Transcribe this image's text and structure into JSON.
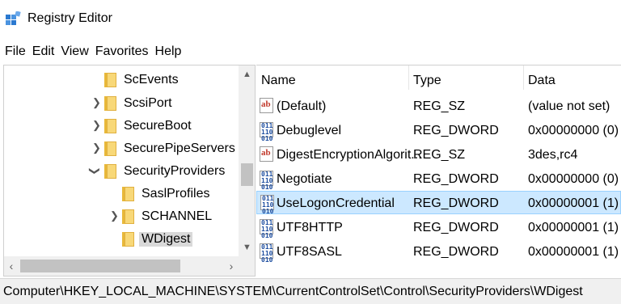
{
  "window": {
    "title": "Registry Editor"
  },
  "menu": [
    "File",
    "Edit",
    "View",
    "Favorites",
    "Help"
  ],
  "tree": [
    {
      "label": "ScEvents",
      "expander": "none"
    },
    {
      "label": "ScsiPort",
      "expander": "collapsed"
    },
    {
      "label": "SecureBoot",
      "expander": "collapsed"
    },
    {
      "label": "SecurePipeServers",
      "expander": "collapsed"
    },
    {
      "label": "SecurityProviders",
      "expander": "expanded"
    },
    {
      "label": "SaslProfiles",
      "expander": "none"
    },
    {
      "label": "SCHANNEL",
      "expander": "collapsed"
    },
    {
      "label": "WDigest",
      "expander": "none",
      "selected": true
    }
  ],
  "list": {
    "headers": {
      "name": "Name",
      "type": "Type",
      "data": "Data"
    },
    "rows": [
      {
        "icon": "string-value-icon",
        "name": "(Default)",
        "type": "REG_SZ",
        "data": "(value not set)"
      },
      {
        "icon": "binary-value-icon",
        "name": "Debuglevel",
        "type": "REG_DWORD",
        "data": "0x00000000 (0)"
      },
      {
        "icon": "string-value-icon",
        "name": "DigestEncryptionAlgorit...",
        "type": "REG_SZ",
        "data": "3des,rc4"
      },
      {
        "icon": "binary-value-icon",
        "name": "Negotiate",
        "type": "REG_DWORD",
        "data": "0x00000000 (0)"
      },
      {
        "icon": "binary-value-icon",
        "name": "UseLogonCredential",
        "type": "REG_DWORD",
        "data": "0x00000001 (1)",
        "selected": true
      },
      {
        "icon": "binary-value-icon",
        "name": "UTF8HTTP",
        "type": "REG_DWORD",
        "data": "0x00000001 (1)"
      },
      {
        "icon": "binary-value-icon",
        "name": "UTF8SASL",
        "type": "REG_DWORD",
        "data": "0x00000001 (1)"
      }
    ]
  },
  "status": {
    "path": "Computer\\HKEY_LOCAL_MACHINE\\SYSTEM\\CurrentControlSet\\Control\\SecurityProviders\\WDigest"
  },
  "colors": {
    "selection": "#cce8ff",
    "selection_border": "#99d1ff",
    "folder": "#f8d878",
    "string_icon": "#c0392b",
    "dword_icon": "#1f4fa0"
  },
  "icons": {
    "app": "registry-editor-icon",
    "folder": "folder-icon",
    "string": "string-value-icon",
    "dword": "binary-value-icon"
  }
}
